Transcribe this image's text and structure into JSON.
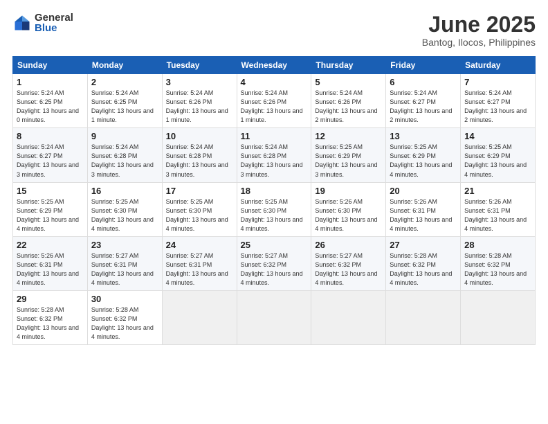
{
  "header": {
    "logo_general": "General",
    "logo_blue": "Blue",
    "month_title": "June 2025",
    "location": "Bantog, Ilocos, Philippines"
  },
  "weekdays": [
    "Sunday",
    "Monday",
    "Tuesday",
    "Wednesday",
    "Thursday",
    "Friday",
    "Saturday"
  ],
  "weeks": [
    [
      {
        "day": "1",
        "sunrise": "5:24 AM",
        "sunset": "6:25 PM",
        "daylight": "13 hours and 0 minutes."
      },
      {
        "day": "2",
        "sunrise": "5:24 AM",
        "sunset": "6:25 PM",
        "daylight": "13 hours and 1 minute."
      },
      {
        "day": "3",
        "sunrise": "5:24 AM",
        "sunset": "6:26 PM",
        "daylight": "13 hours and 1 minute."
      },
      {
        "day": "4",
        "sunrise": "5:24 AM",
        "sunset": "6:26 PM",
        "daylight": "13 hours and 1 minute."
      },
      {
        "day": "5",
        "sunrise": "5:24 AM",
        "sunset": "6:26 PM",
        "daylight": "13 hours and 2 minutes."
      },
      {
        "day": "6",
        "sunrise": "5:24 AM",
        "sunset": "6:27 PM",
        "daylight": "13 hours and 2 minutes."
      },
      {
        "day": "7",
        "sunrise": "5:24 AM",
        "sunset": "6:27 PM",
        "daylight": "13 hours and 2 minutes."
      }
    ],
    [
      {
        "day": "8",
        "sunrise": "5:24 AM",
        "sunset": "6:27 PM",
        "daylight": "13 hours and 3 minutes."
      },
      {
        "day": "9",
        "sunrise": "5:24 AM",
        "sunset": "6:28 PM",
        "daylight": "13 hours and 3 minutes."
      },
      {
        "day": "10",
        "sunrise": "5:24 AM",
        "sunset": "6:28 PM",
        "daylight": "13 hours and 3 minutes."
      },
      {
        "day": "11",
        "sunrise": "5:24 AM",
        "sunset": "6:28 PM",
        "daylight": "13 hours and 3 minutes."
      },
      {
        "day": "12",
        "sunrise": "5:25 AM",
        "sunset": "6:29 PM",
        "daylight": "13 hours and 3 minutes."
      },
      {
        "day": "13",
        "sunrise": "5:25 AM",
        "sunset": "6:29 PM",
        "daylight": "13 hours and 4 minutes."
      },
      {
        "day": "14",
        "sunrise": "5:25 AM",
        "sunset": "6:29 PM",
        "daylight": "13 hours and 4 minutes."
      }
    ],
    [
      {
        "day": "15",
        "sunrise": "5:25 AM",
        "sunset": "6:29 PM",
        "daylight": "13 hours and 4 minutes."
      },
      {
        "day": "16",
        "sunrise": "5:25 AM",
        "sunset": "6:30 PM",
        "daylight": "13 hours and 4 minutes."
      },
      {
        "day": "17",
        "sunrise": "5:25 AM",
        "sunset": "6:30 PM",
        "daylight": "13 hours and 4 minutes."
      },
      {
        "day": "18",
        "sunrise": "5:25 AM",
        "sunset": "6:30 PM",
        "daylight": "13 hours and 4 minutes."
      },
      {
        "day": "19",
        "sunrise": "5:26 AM",
        "sunset": "6:30 PM",
        "daylight": "13 hours and 4 minutes."
      },
      {
        "day": "20",
        "sunrise": "5:26 AM",
        "sunset": "6:31 PM",
        "daylight": "13 hours and 4 minutes."
      },
      {
        "day": "21",
        "sunrise": "5:26 AM",
        "sunset": "6:31 PM",
        "daylight": "13 hours and 4 minutes."
      }
    ],
    [
      {
        "day": "22",
        "sunrise": "5:26 AM",
        "sunset": "6:31 PM",
        "daylight": "13 hours and 4 minutes."
      },
      {
        "day": "23",
        "sunrise": "5:27 AM",
        "sunset": "6:31 PM",
        "daylight": "13 hours and 4 minutes."
      },
      {
        "day": "24",
        "sunrise": "5:27 AM",
        "sunset": "6:31 PM",
        "daylight": "13 hours and 4 minutes."
      },
      {
        "day": "25",
        "sunrise": "5:27 AM",
        "sunset": "6:32 PM",
        "daylight": "13 hours and 4 minutes."
      },
      {
        "day": "26",
        "sunrise": "5:27 AM",
        "sunset": "6:32 PM",
        "daylight": "13 hours and 4 minutes."
      },
      {
        "day": "27",
        "sunrise": "5:28 AM",
        "sunset": "6:32 PM",
        "daylight": "13 hours and 4 minutes."
      },
      {
        "day": "28",
        "sunrise": "5:28 AM",
        "sunset": "6:32 PM",
        "daylight": "13 hours and 4 minutes."
      }
    ],
    [
      {
        "day": "29",
        "sunrise": "5:28 AM",
        "sunset": "6:32 PM",
        "daylight": "13 hours and 4 minutes."
      },
      {
        "day": "30",
        "sunrise": "5:28 AM",
        "sunset": "6:32 PM",
        "daylight": "13 hours and 4 minutes."
      },
      null,
      null,
      null,
      null,
      null
    ]
  ]
}
